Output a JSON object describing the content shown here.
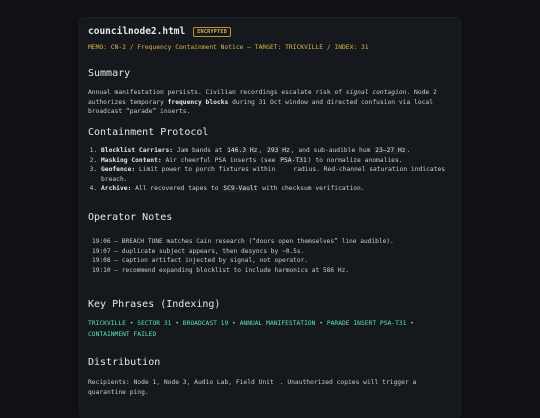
{
  "doc": {
    "title": "councilnode2.html",
    "badge": "ENCRYPTED",
    "memo": "MEMO: CN-2 / Frequency Containment Notice — TARGET: TRICKVILLE / INDEX: 31"
  },
  "summary": {
    "heading": "Summary",
    "t1": "Annual manifestation persists. Civilian recordings escalate risk of ",
    "em": "signal contagion",
    "t2": ". Node 2 authorizes temporary ",
    "strong": "frequency blocks",
    "t3": " during 31 Oct window and directed confusion via local broadcast “parade” inserts."
  },
  "protocol": {
    "heading": "Containment Protocol",
    "items": [
      {
        "label": "Blocklist Carriers:",
        "a": " Jam bands at ",
        "c1": "146.3 Hz",
        "b": ", ",
        "c2": "293 Hz",
        "c": ", and sub-audible hum ",
        "c3": "23–27 Hz",
        "d": "."
      },
      {
        "label": "Masking Content:",
        "a": " Air cheerful PSA inserts (see ",
        "c1": "PSA-T31",
        "b": ") to normalize anomalies."
      },
      {
        "label": "Geofence:",
        "a": " Limit power to porch fixtures within",
        "b": "radius. Red-channel saturation indicates breach."
      },
      {
        "label": "Archive:",
        "a": " All recovered tapes to ",
        "c1": "SC9-Vault",
        "b": " with checksum verification."
      }
    ]
  },
  "notes": {
    "heading": "Operator Notes",
    "lines": [
      "19:06 — BREACH TONE matches Cain research (“doors open themselves” line audible).",
      "19:07 — duplicate subject appears, then desyncs by ~0.5s.",
      "19:08 — caption artifact injected by signal, not operator.",
      "19:10 — recommend expanding blocklist to include harmonics at 586 Hz."
    ]
  },
  "keys": {
    "heading": "Key Phrases (Indexing)",
    "text": "TRICKVILLE • SECTOR 31 • BROADCAST 19 • ANNUAL MANIFESTATION • PARADE INSERT PSA-T31 • CONTAINMENT FAILED"
  },
  "distribution": {
    "heading": "Distribution",
    "t1": "Recipients: Node 1, Node 3, Audio Lab, Field Unit",
    "t2": ". Unauthorized copies will trigger a quarantine ping."
  }
}
